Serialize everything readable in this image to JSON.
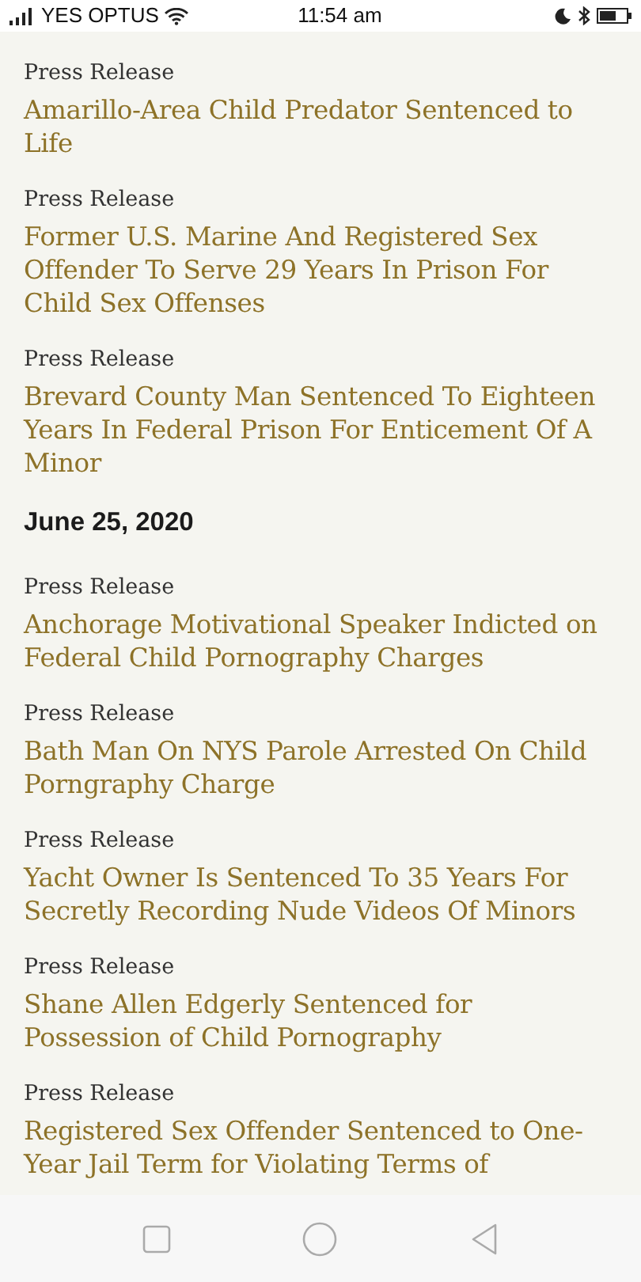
{
  "status_bar": {
    "carrier": "YES OPTUS",
    "time": "11:54 am"
  },
  "items": [
    {
      "kind": "release",
      "label": "Press Release",
      "title": "Amarillo-Area Child Predator Sentenced to Life"
    },
    {
      "kind": "release",
      "label": "Press Release",
      "title": "Former U.S. Marine And Registered Sex Offender To Serve 29 Years In Prison For Child Sex Offenses"
    },
    {
      "kind": "release",
      "label": "Press Release",
      "title": "Brevard County Man Sentenced To Eighteen Years In Federal Prison For Enticement Of A Minor"
    },
    {
      "kind": "date",
      "text": "June 25, 2020"
    },
    {
      "kind": "release",
      "label": "Press Release",
      "title": "Anchorage Motivational Speaker Indicted on Federal Child Pornography Charges"
    },
    {
      "kind": "release",
      "label": "Press Release",
      "title": "Bath Man On NYS Parole Arrested On Child Porngraphy Charge"
    },
    {
      "kind": "release",
      "label": "Press Release",
      "title": "Yacht Owner Is Sentenced To 35 Years For Secretly Recording Nude Videos Of Minors"
    },
    {
      "kind": "release",
      "label": "Press Release",
      "title": "Shane Allen Edgerly Sentenced for Possession of Child Pornography"
    },
    {
      "kind": "release",
      "label": "Press Release",
      "title": "Registered Sex Offender Sentenced to One-Year Jail Term for Violating Terms of"
    }
  ]
}
